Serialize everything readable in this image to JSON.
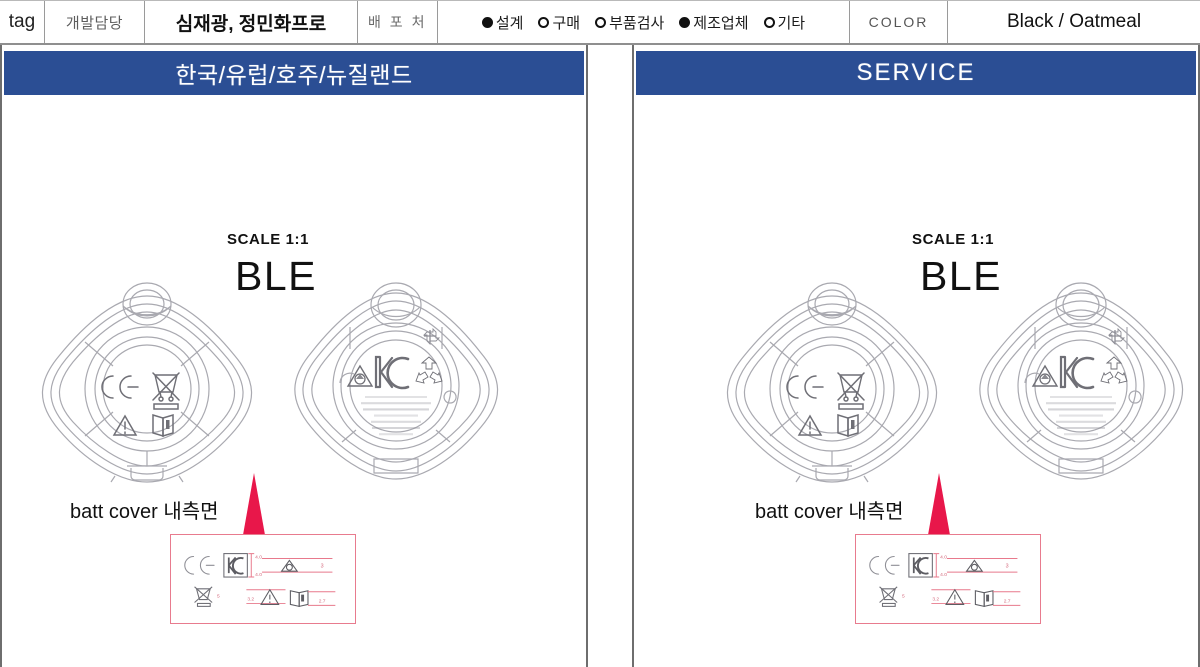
{
  "meta_row": {
    "tag_label": "tag",
    "role_label": "개발담당",
    "names": "심재광, 정민화프로",
    "distribution_label": "배 포 처",
    "radio_options": [
      {
        "label": "설계",
        "selected": true
      },
      {
        "label": "구매",
        "selected": false
      },
      {
        "label": "부품검사",
        "selected": false
      },
      {
        "label": "제조업체",
        "selected": true
      },
      {
        "label": "기타",
        "selected": false
      }
    ],
    "color_label": "COLOR",
    "color_value": "Black / Oatmeal"
  },
  "panels": [
    {
      "id": "left",
      "banner_title": "한국/유럽/호주/뉴질랜드",
      "banner_style": "korean",
      "scale": "SCALE 1:1",
      "product": "BLE",
      "batt_cover_label": "batt cover 내측면",
      "front_marks": [
        "CE",
        "WEEE",
        "warning-triangle",
        "read-manual"
      ],
      "back_marks": [
        "RCM",
        "KC",
        "recycle"
      ],
      "back_label_lines": [
        "MODEL : EI-T7300  RATING : DC 3V",
        "해당 무선설비는 운용 중 전파혼신 가능성이 있음",
        "이 기기는 가정용(B급) 전자파적합기기로서",
        "Samsung Electronics Co., Ltd.",
        "129, Samsung-ro, Yeongtong-gu",
        "Suwon-si, Gyeonggi-do, Korea",
        "Made in Vietnam"
      ],
      "callout_symbols": [
        {
          "name": "ce-mark",
          "dim": ""
        },
        {
          "name": "kc-mark",
          "dim": "4.0"
        },
        {
          "name": "rcm-mark",
          "dim": "3"
        },
        {
          "name": "weee-bin",
          "dim": "5"
        },
        {
          "name": "warning-triangle",
          "dim": "3.2"
        },
        {
          "name": "read-manual",
          "dim": "2.7"
        }
      ]
    },
    {
      "id": "right",
      "banner_title": "SERVICE",
      "banner_style": "latin",
      "scale": "SCALE 1:1",
      "product": "BLE",
      "batt_cover_label": "batt cover 내측면",
      "front_marks": [
        "CE",
        "WEEE",
        "warning-triangle",
        "read-manual"
      ],
      "back_marks": [
        "RCM",
        "KC",
        "recycle"
      ],
      "back_label_lines": [
        "MODEL : EI-T7300  RATING : DC 3V",
        "해당 무선설비는 운용 중 전파혼신 가능성이 있음",
        "이 기기는 가정용(B급) 전자파적합기기로서",
        "Samsung Electronics Co., Ltd.",
        "129, Samsung-ro, Yeongtong-gu",
        "Suwon-si, Gyeonggi-do, Korea",
        "Made in Vietnam"
      ],
      "callout_symbols": [
        {
          "name": "ce-mark",
          "dim": ""
        },
        {
          "name": "kc-mark",
          "dim": "4.0"
        },
        {
          "name": "rcm-mark",
          "dim": "3"
        },
        {
          "name": "weee-bin",
          "dim": "5"
        },
        {
          "name": "warning-triangle",
          "dim": "3.2"
        },
        {
          "name": "read-manual",
          "dim": "2.7"
        }
      ]
    }
  ],
  "colors": {
    "banner_blue": "#2b4e94",
    "callout_red": "#e87b8e",
    "arrow_red": "#e8174a",
    "drawing_gray": "#9a9aa0",
    "text_dark": "#111111"
  }
}
